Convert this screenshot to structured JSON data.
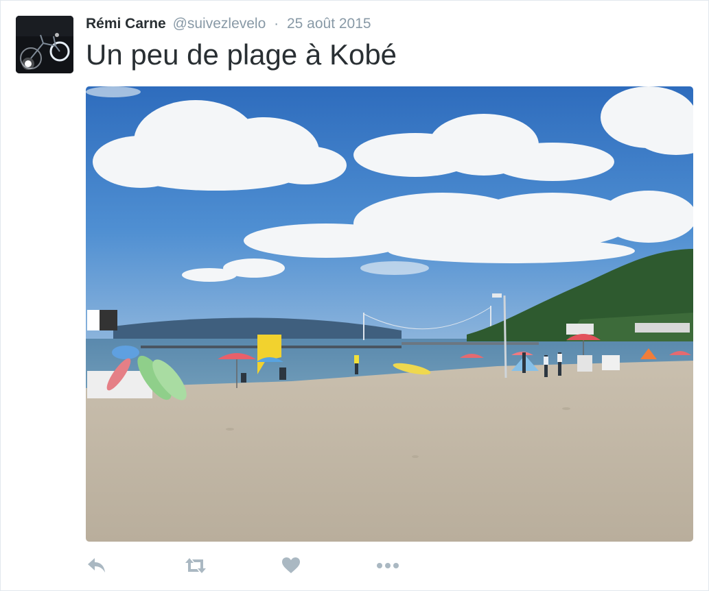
{
  "tweet": {
    "author_name": "Rémi Carne",
    "author_handle": "@suivezlevelo",
    "separator": "·",
    "date": "25 août 2015",
    "text": "Un peu de plage à Kobé"
  },
  "photo": {
    "icon": "beach-photo"
  },
  "actions": [
    {
      "name": "reply",
      "icon": "reply-icon"
    },
    {
      "name": "retweet",
      "icon": "retweet-icon"
    },
    {
      "name": "like",
      "icon": "heart-icon"
    },
    {
      "name": "more",
      "icon": "more-icon"
    }
  ],
  "colors": {
    "name": "#292f33",
    "muted": "#8899a6",
    "action_icon": "#aab8c2",
    "border": "#e1e8ed"
  }
}
